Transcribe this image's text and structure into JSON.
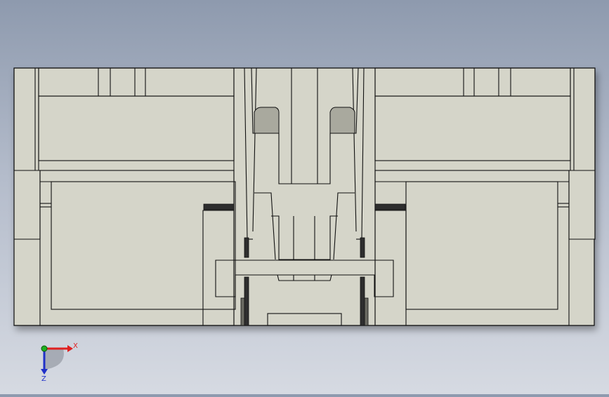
{
  "viewport": {
    "background_top": "#8e9aae",
    "background_bottom": "#d6dae2",
    "part_face_color": "#d5d5c9",
    "part_edge_color": "#111111",
    "slot_color": "#2e2e2e"
  },
  "triad": {
    "x_label": "X",
    "z_label": "Z",
    "x_color": "#e02020",
    "z_color": "#2030c8",
    "y_color": "#20b020"
  }
}
